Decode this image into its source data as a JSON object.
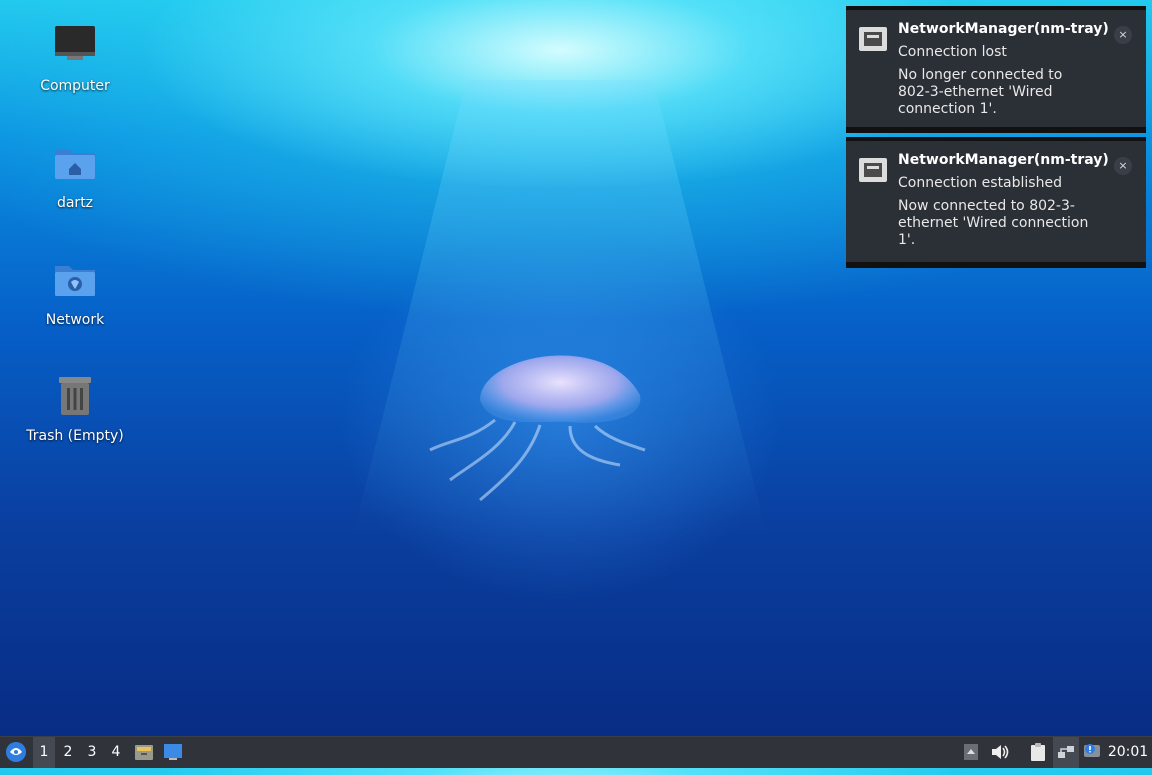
{
  "desktop": {
    "icons": [
      {
        "label": "Computer",
        "icon": "computer-icon"
      },
      {
        "label": "dartz",
        "icon": "home-folder-icon"
      },
      {
        "label": "Network",
        "icon": "network-folder-icon"
      },
      {
        "label": "Trash (Empty)",
        "icon": "trash-icon"
      }
    ]
  },
  "notifications": [
    {
      "app": "NetworkManager(nm-tray)",
      "summary": "Connection lost",
      "body": "No longer connected to 802-3-ethernet 'Wired connection 1'.",
      "close": "×",
      "icon": "ethernet-icon"
    },
    {
      "app": "NetworkManager(nm-tray)",
      "summary": "Connection established",
      "body": "Now connected to 802-3-ethernet 'Wired connection 1'.",
      "close": "×",
      "icon": "ethernet-icon"
    }
  ],
  "taskbar": {
    "workspaces": [
      "1",
      "2",
      "3",
      "4"
    ],
    "active_workspace": "1",
    "clock": "20:01",
    "colors": {
      "panel": "#30343a",
      "accent": "#2f7de1"
    }
  }
}
